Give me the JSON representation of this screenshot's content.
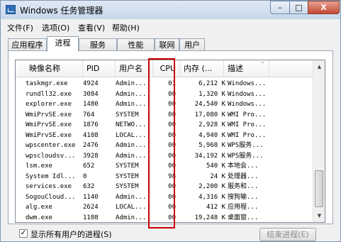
{
  "window": {
    "title": "Windows 任务管理器",
    "min": "–",
    "max": "□",
    "close": "X"
  },
  "menu": [
    "文件(F)",
    "选项(O)",
    "查看(V)",
    "帮助(H)"
  ],
  "tabs": [
    "应用程序",
    "进程",
    "服务",
    "性能",
    "联网",
    "用户"
  ],
  "active_tab": "进程",
  "columns": {
    "name": "映像名称",
    "pid": "PID",
    "user": "用户名",
    "cpu": "CPU",
    "mem": "内存 (...",
    "desc": "描述"
  },
  "processes": [
    {
      "name": "taskmgr.exe",
      "pid": "4924",
      "user": "Admin...",
      "cpu": "01",
      "mem": "6,212 K",
      "desc": "Windows..."
    },
    {
      "name": "rundll32.exe",
      "pid": "3084",
      "user": "Admin...",
      "cpu": "00",
      "mem": "1,320 K",
      "desc": "Windows..."
    },
    {
      "name": "explorer.exe",
      "pid": "1480",
      "user": "Admin...",
      "cpu": "00",
      "mem": "24,540 K",
      "desc": "Windows..."
    },
    {
      "name": "WmiPrvSE.exe",
      "pid": "764",
      "user": "SYSTEM",
      "cpu": "00",
      "mem": "17,080 K",
      "desc": "WMI Pro..."
    },
    {
      "name": "WmiPrvSE.exe",
      "pid": "1876",
      "user": "NETWO...",
      "cpu": "00",
      "mem": "2,928 K",
      "desc": "WMI Pro..."
    },
    {
      "name": "WmiPrvSE.exe",
      "pid": "4108",
      "user": "LOCAL...",
      "cpu": "00",
      "mem": "4,940 K",
      "desc": "WMI Pro..."
    },
    {
      "name": "wpscenter.exe",
      "pid": "2476",
      "user": "Admin...",
      "cpu": "00",
      "mem": "5,968 K",
      "desc": "WPS服务..."
    },
    {
      "name": "wpscloudsv...",
      "pid": "3928",
      "user": "Admin...",
      "cpu": "00",
      "mem": "34,192 K",
      "desc": "WPS服务..."
    },
    {
      "name": "lsm.exe",
      "pid": "652",
      "user": "SYSTEM",
      "cpu": "00",
      "mem": "540 K",
      "desc": "本地会..."
    },
    {
      "name": "System Idl...",
      "pid": "0",
      "user": "SYSTEM",
      "cpu": "98",
      "mem": "24 K",
      "desc": "处理器..."
    },
    {
      "name": "services.exe",
      "pid": "632",
      "user": "SYSTEM",
      "cpu": "00",
      "mem": "2,200 K",
      "desc": "服务和..."
    },
    {
      "name": "SogouCloud...",
      "pid": "1140",
      "user": "Admin...",
      "cpu": "00",
      "mem": "4,316 K",
      "desc": "搜狗输..."
    },
    {
      "name": "alg.exe",
      "pid": "2624",
      "user": "LOCAL...",
      "cpu": "00",
      "mem": "412 K",
      "desc": "应用程..."
    },
    {
      "name": "dwm.exe",
      "pid": "1108",
      "user": "Admin...",
      "cpu": "00",
      "mem": "19,248 K",
      "desc": "桌面窗..."
    }
  ],
  "show_all_label": "显示所有用户的进程(S)",
  "show_all_checked": "✓",
  "end_process_label": "结束进程(E)",
  "scroll": {
    "up": "▲",
    "down": "▼"
  },
  "sort_glyph": "⌃"
}
